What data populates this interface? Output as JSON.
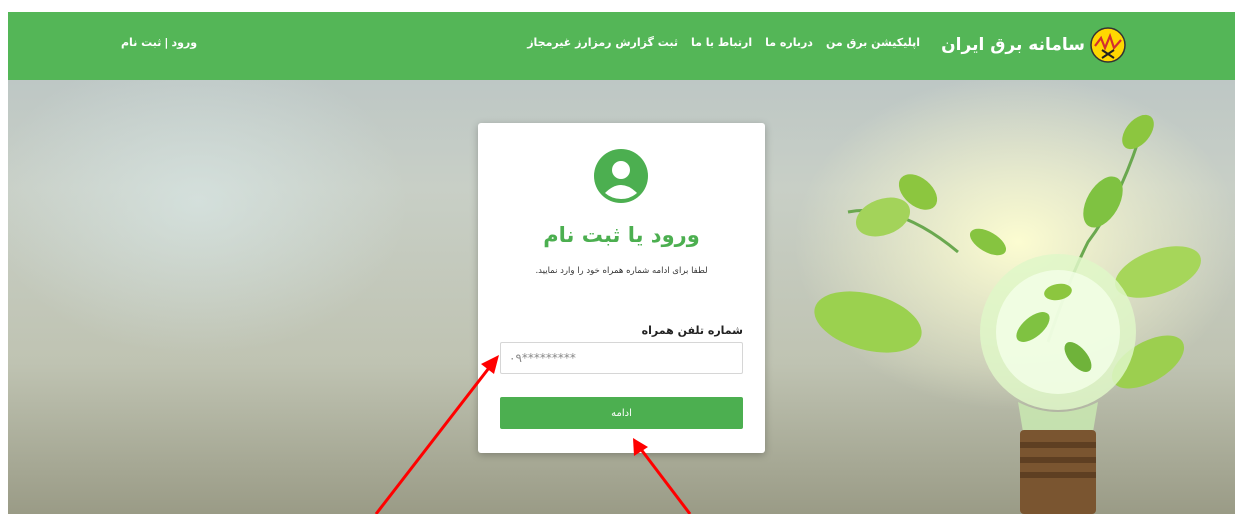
{
  "header": {
    "brand_title": "سامانه برق ایران",
    "nav": [
      {
        "label": "اپلیکیشن برق من"
      },
      {
        "label": "درباره ما"
      },
      {
        "label": "ارتباط با ما"
      },
      {
        "label": "ثبت گزارش رمزارز غیرمجاز"
      }
    ],
    "login_label": "ورود",
    "separator": "|",
    "register_label": "ثبت نام"
  },
  "card": {
    "title": "ورود یا ثبت نام",
    "subtitle": "لطفا برای ادامه شماره همراه خود را وارد نمایید.",
    "phone_label": "شماره تلفن همراه",
    "phone_placeholder": "۰۹*********",
    "continue_label": "ادامه"
  },
  "colors": {
    "primary_green": "#54b657",
    "button_green": "#4caf50",
    "annotation_red": "#ff0000"
  }
}
